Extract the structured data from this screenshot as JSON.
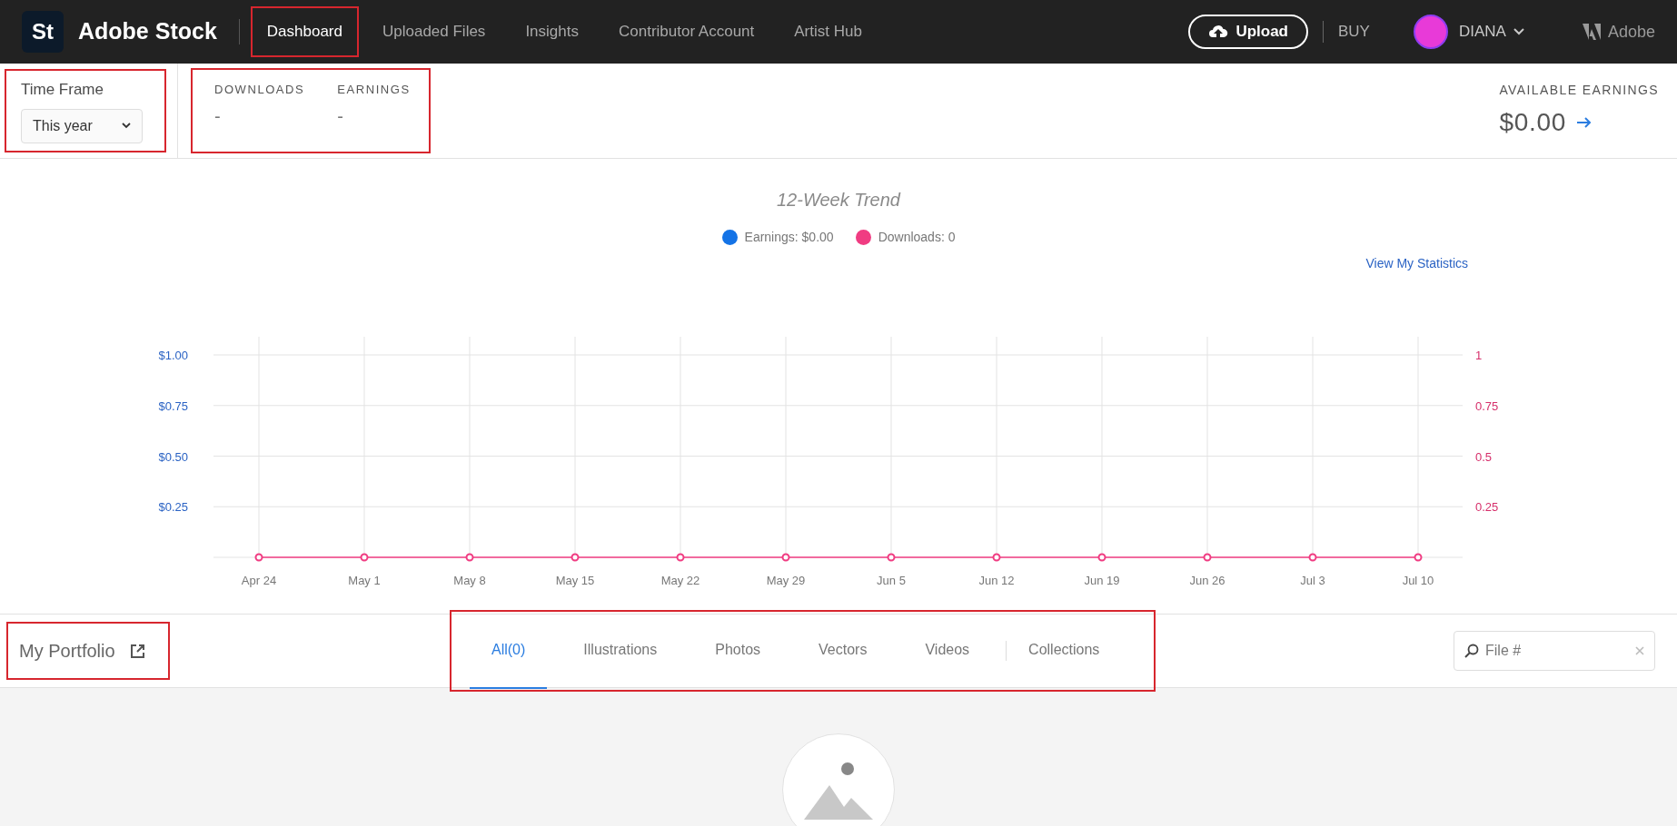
{
  "header": {
    "logo_mark": "St",
    "brand": "Adobe Stock",
    "nav": [
      {
        "label": "Dashboard",
        "selected": true,
        "highlighted": true
      },
      {
        "label": "Uploaded Files",
        "selected": false,
        "highlighted": false
      },
      {
        "label": "Insights",
        "selected": false,
        "highlighted": false
      },
      {
        "label": "Contributor Account",
        "selected": false,
        "highlighted": false
      },
      {
        "label": "Artist Hub",
        "selected": false,
        "highlighted": false
      }
    ],
    "upload_button": "Upload",
    "buy_link": "BUY",
    "user_name": "DIANA",
    "adobe_label": "Adobe"
  },
  "time_frame": {
    "label": "Time Frame",
    "value": "This year",
    "highlighted": true
  },
  "stats": {
    "highlighted": true,
    "items": [
      {
        "label": "DOWNLOADS",
        "value": "-"
      },
      {
        "label": "EARNINGS",
        "value": "-"
      }
    ]
  },
  "available_earnings": {
    "label": "AVAILABLE EARNINGS",
    "value": "$0.00"
  },
  "trend": {
    "title": "12-Week Trend",
    "view_link": "View My Statistics",
    "legend": [
      {
        "label": "Earnings: $0.00",
        "color": "#1473e6"
      },
      {
        "label": "Downloads: 0",
        "color": "#f03c82"
      }
    ],
    "right_axis_labels": [
      "1",
      "0.75",
      "0.5",
      "0.25"
    ],
    "chart_data": {
      "type": "line",
      "grid": true,
      "categories": [
        "Apr 24",
        "May 1",
        "May 8",
        "May 15",
        "May 22",
        "May 29",
        "Jun 5",
        "Jun 12",
        "Jun 19",
        "Jun 26",
        "Jul 3",
        "Jul 10"
      ],
      "series": [
        {
          "color": "#f03c82",
          "marker": "circle",
          "values": [
            0,
            0,
            0,
            0,
            0,
            0,
            0,
            0,
            0,
            0,
            0,
            0
          ]
        }
      ],
      "ylim": [
        0,
        1
      ],
      "yticks": [
        {
          "value": 0.25,
          "label": "$0.25"
        },
        {
          "value": 0.5,
          "label": "$0.50"
        },
        {
          "value": 0.75,
          "label": "$0.75"
        },
        {
          "value": 1,
          "label": "$1.00"
        }
      ]
    }
  },
  "portfolio": {
    "title": "My Portfolio",
    "title_highlighted": true,
    "tabs_highlighted": true,
    "tabs": [
      {
        "label": "All(0)",
        "selected": true
      },
      {
        "label": "Illustrations",
        "selected": false
      },
      {
        "label": "Photos",
        "selected": false
      },
      {
        "label": "Vectors",
        "selected": false
      },
      {
        "label": "Videos",
        "selected": false
      },
      {
        "label": "Collections",
        "selected": false
      }
    ],
    "search": {
      "placeholder": "File #"
    }
  }
}
